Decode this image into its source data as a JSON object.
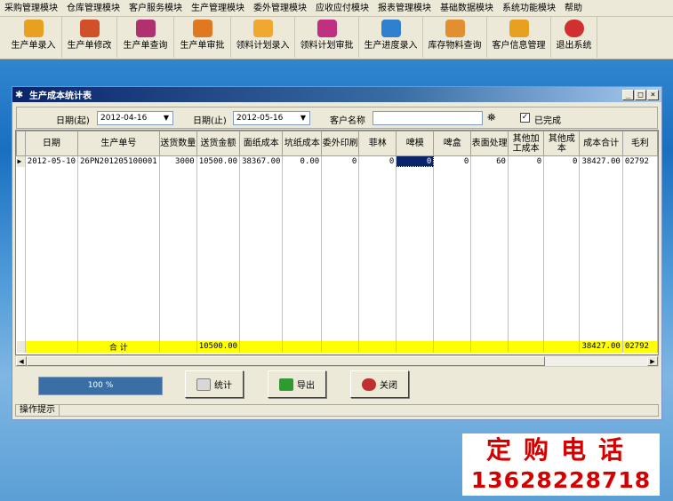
{
  "menubar": {
    "items": [
      "采购管理模块",
      "仓库管理模块",
      "客户服务模块",
      "生产管理模块",
      "委外管理模块",
      "应收应付模块",
      "报表管理模块",
      "基础数据模块",
      "系统功能模块",
      "帮助"
    ]
  },
  "toolbar": {
    "buttons": [
      {
        "label": "生产单录入",
        "icon": "order-entry-icon",
        "color": "#e8a020"
      },
      {
        "label": "生产单修改",
        "icon": "order-edit-icon",
        "color": "#d0502a"
      },
      {
        "label": "生产单查询",
        "icon": "order-query-icon",
        "color": "#b03070"
      },
      {
        "label": "生产单审批",
        "icon": "order-approve-icon",
        "color": "#e07820"
      },
      {
        "label": "领料计划录入",
        "icon": "material-plan-entry-icon",
        "color": "#f0a830"
      },
      {
        "label": "领料计划审批",
        "icon": "material-plan-approve-icon",
        "color": "#c03080"
      },
      {
        "label": "生产进度录入",
        "icon": "progress-entry-icon",
        "color": "#3080d0"
      },
      {
        "label": "库存物料查询",
        "icon": "inventory-query-icon",
        "color": "#e09030"
      },
      {
        "label": "客户信息管理",
        "icon": "customer-info-icon",
        "color": "#e8a020"
      },
      {
        "label": "退出系统",
        "icon": "exit-icon",
        "color": "#d03030"
      }
    ]
  },
  "window": {
    "title": "生产成本统计表",
    "controls": {
      "minimize": "_",
      "maximize": "□",
      "close": "×"
    }
  },
  "filter": {
    "date_start_label": "日期(起)",
    "date_start_value": "2012-04-16",
    "date_end_label": "日期(止)",
    "date_end_value": "2012-05-16",
    "customer_label": "客户名称",
    "customer_value": "",
    "completed_label": "已完成",
    "completed_checked": "✓"
  },
  "grid": {
    "columns": [
      "日期",
      "生产单号",
      "送货数量",
      "送货金额",
      "面纸成本",
      "坑纸成本",
      "委外印刷",
      "菲林",
      "啤模",
      "啤盒",
      "表面处理",
      "其他加工成本",
      "其他成本",
      "成本合计",
      "毛利"
    ],
    "rows": [
      [
        "2012-05-10",
        "26PN201205100001",
        "3000",
        "10500.00",
        "38367.00",
        "0.00",
        "0",
        "0",
        "0",
        "0",
        "60",
        "0",
        "0",
        "38427.00",
        "02792"
      ]
    ],
    "summary": {
      "label": "合  计",
      "amount": "10500.00",
      "cost_total": "38427.00",
      "profit": "02792"
    }
  },
  "progress": {
    "text": "100 %",
    "value_percent": 100
  },
  "buttons": {
    "stats": "统计",
    "export": "导出",
    "close": "关闭"
  },
  "statusbar": {
    "hint": "操作提示"
  },
  "ad": {
    "line1": "定购电话",
    "line2": "13628228718"
  }
}
